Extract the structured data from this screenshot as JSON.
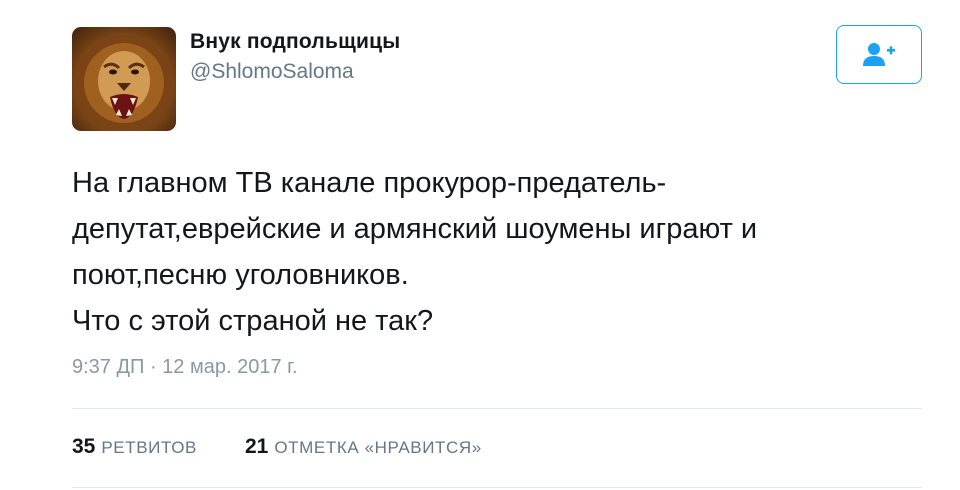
{
  "user": {
    "display_name": "Внук подпольщицы",
    "handle": "@ShlomoSaloma",
    "avatar_icon": "lion-avatar"
  },
  "follow_button": {
    "icon": "add-user-icon",
    "color": "#1da1f2"
  },
  "tweet": {
    "text": "На главном ТВ канале прокурор-предатель-\nдепутат,еврейские и армянский шоумены играют и\nпоют,песню уголовников.\nЧто с этой страной не так?",
    "timestamp": "9:37 ДП · 12 мар. 2017 г."
  },
  "stats": {
    "retweets": {
      "count": "35",
      "label": "РЕТВИТОВ"
    },
    "likes": {
      "count": "21",
      "label": "ОТМЕТКА «НРАВИТСЯ»"
    }
  }
}
